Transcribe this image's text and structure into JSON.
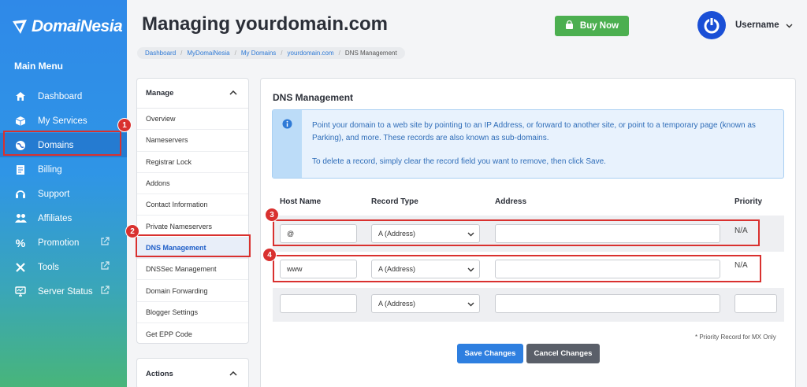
{
  "brand": {
    "name": "DomaiNesia"
  },
  "sidebar": {
    "title": "Main Menu",
    "items": [
      {
        "label": "Dashboard",
        "icon": "home-icon"
      },
      {
        "label": "My Services",
        "icon": "cube-icon"
      },
      {
        "label": "Domains",
        "icon": "globe-icon",
        "active": true
      },
      {
        "label": "Billing",
        "icon": "document-icon"
      },
      {
        "label": "Support",
        "icon": "headset-icon"
      },
      {
        "label": "Affiliates",
        "icon": "people-icon"
      },
      {
        "label": "Promotion",
        "icon": "percent-icon",
        "external": true
      },
      {
        "label": "Tools",
        "icon": "tools-icon",
        "external": true
      },
      {
        "label": "Server Status",
        "icon": "monitor-icon",
        "external": true
      }
    ]
  },
  "header": {
    "title": "Managing yourdomain.com",
    "buy_label": "Buy Now",
    "username": "Username"
  },
  "breadcrumb": [
    "Dashboard",
    "MyDomaiNesia",
    "My Domains",
    "yourdomain.com",
    "DNS Management"
  ],
  "manage": {
    "title": "Manage",
    "items": [
      "Overview",
      "Nameservers",
      "Registrar Lock",
      "Addons",
      "Contact Information",
      "Private Nameservers",
      "DNS Management",
      "DNSSec Management",
      "Domain Forwarding",
      "Blogger Settings",
      "Get EPP Code"
    ],
    "active_index": 6
  },
  "actions": {
    "title": "Actions"
  },
  "dns": {
    "title": "DNS Management",
    "info_line1": "Point your domain to a web site by pointing to an IP Address, or forward to another site, or point to a temporary page (known as Parking), and more. These records are also known as sub-domains.",
    "info_line2": "To delete a record, simply clear the record field you want to remove, then click Save.",
    "columns": [
      "Host Name",
      "Record Type",
      "Address",
      "Priority"
    ],
    "rows": [
      {
        "host": "@",
        "type": "A (Address)",
        "address": "",
        "priority": "N/A"
      },
      {
        "host": "www",
        "type": "A (Address)",
        "address": "",
        "priority": "N/A"
      },
      {
        "host": "",
        "type": "A (Address)",
        "address": "",
        "priority": ""
      }
    ],
    "note": "* Priority Record for MX Only",
    "save_label": "Save Changes",
    "cancel_label": "Cancel Changes"
  },
  "annotations": [
    "1",
    "2",
    "3",
    "4"
  ],
  "colors": {
    "accent": "#2e7fe0",
    "annotation": "#d9312f",
    "buy": "#4caf50"
  }
}
